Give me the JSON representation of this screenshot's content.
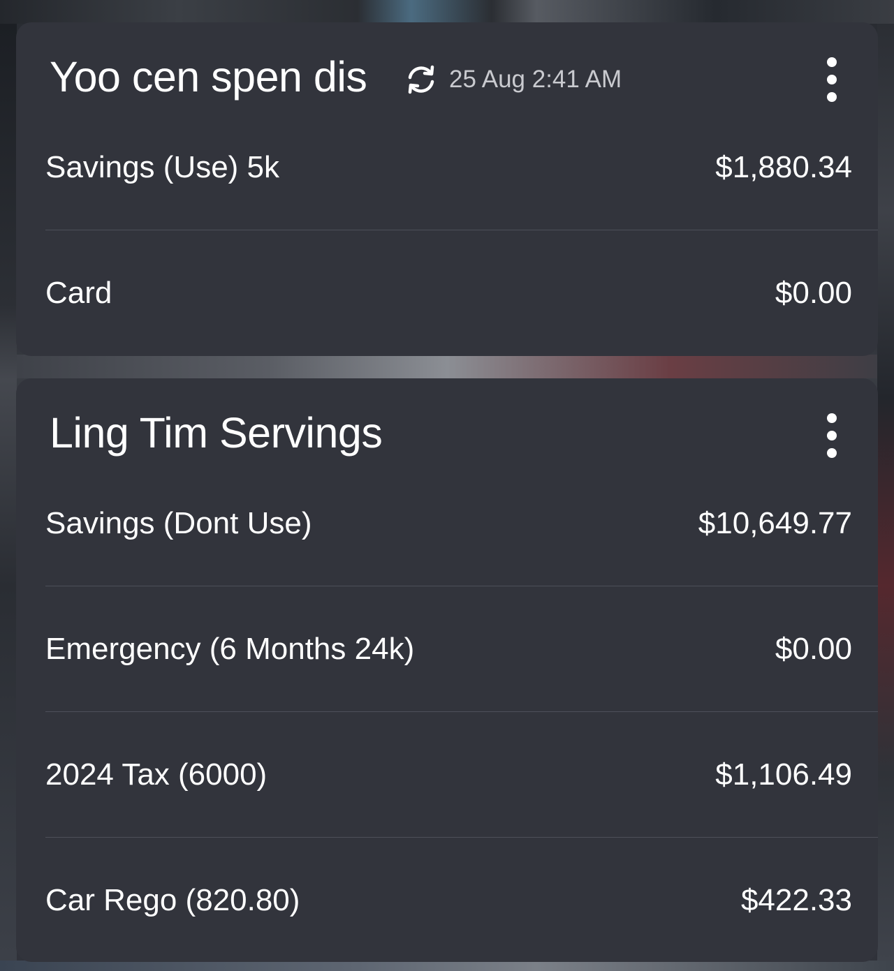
{
  "widgets": [
    {
      "title": "Yoo cen spen dis",
      "sync_time": "25 Aug 2:41 AM",
      "sync_icon": "refresh-icon",
      "menu_icon": "more-vertical-icon",
      "accounts": [
        {
          "label": "Savings (Use) 5k",
          "amount": "$1,880.34"
        },
        {
          "label": "Card",
          "amount": "$0.00"
        }
      ]
    },
    {
      "title": "Ling Tim Servings",
      "menu_icon": "more-vertical-icon",
      "accounts": [
        {
          "label": "Savings (Dont Use)",
          "amount": "$10,649.77"
        },
        {
          "label": "Emergency (6 Months 24k)",
          "amount": "$0.00"
        },
        {
          "label": "2024 Tax (6000)",
          "amount": "$1,106.49"
        },
        {
          "label": "Car Rego (820.80)",
          "amount": "$422.33"
        }
      ]
    }
  ],
  "colors": {
    "card_background": "#32343c",
    "text_primary": "#ffffff",
    "text_secondary": "#c9cacf",
    "divider": "#4d505a"
  }
}
